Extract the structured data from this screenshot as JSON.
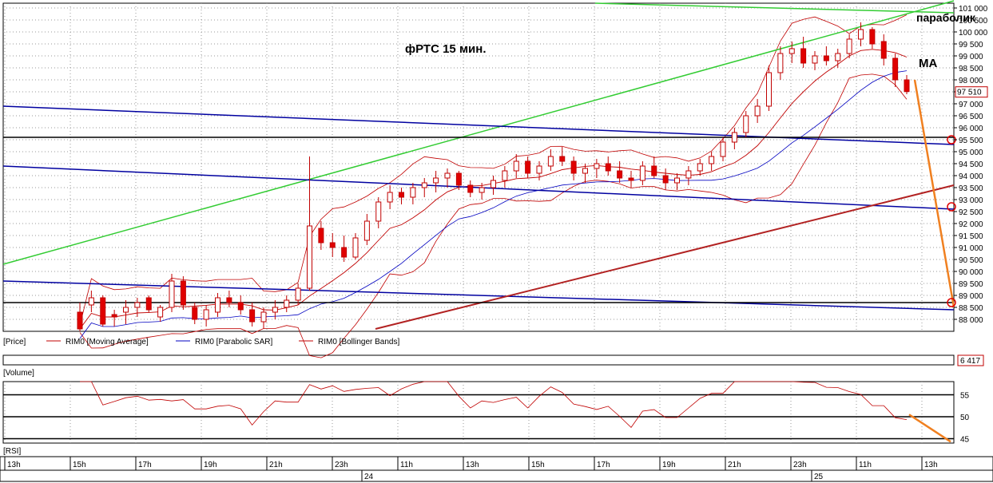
{
  "chart_data": {
    "type": "candlestick",
    "title": "фРТС   15 мин.",
    "annotations": {
      "parabolic": "параболик",
      "ma": "MA"
    },
    "price_panel": {
      "label": "[Price]",
      "ylim": [
        87500,
        101200
      ],
      "yticks": [
        "88 000",
        "88 500",
        "89 000",
        "89 500",
        "90 000",
        "90 500",
        "91 000",
        "91 500",
        "92 000",
        "92 500",
        "93 000",
        "93 500",
        "94 000",
        "94 500",
        "95 000",
        "95 500",
        "96 000",
        "96 500",
        "97 000",
        "97 500",
        "98 000",
        "98 500",
        "99 000",
        "99 500",
        "100 000",
        "100 500",
        "101 000"
      ],
      "last_price": "97 510",
      "last_price_value": 97510,
      "legend": [
        {
          "name": "RIM0 [Moving Average]",
          "color": "#c00000"
        },
        {
          "name": "RIM0 [Parabolic SAR]",
          "color": "#0000c0"
        },
        {
          "name": "RIM0 [Bollinger Bands]",
          "color": "#c00000"
        }
      ],
      "candles": [
        [
          88300,
          88700,
          87500,
          87600
        ],
        [
          88600,
          89200,
          88300,
          88900
        ],
        [
          88900,
          89000,
          87700,
          87800
        ],
        [
          88200,
          88400,
          87700,
          88100
        ],
        [
          88300,
          88800,
          87800,
          88500
        ],
        [
          88500,
          88900,
          88100,
          88700
        ],
        [
          88900,
          89000,
          88300,
          88400
        ],
        [
          88100,
          88600,
          87900,
          88500
        ],
        [
          88500,
          89900,
          88300,
          89600
        ],
        [
          89600,
          89800,
          88400,
          88600
        ],
        [
          88500,
          88700,
          87800,
          88000
        ],
        [
          88000,
          88600,
          87700,
          88400
        ],
        [
          88300,
          89100,
          88100,
          88900
        ],
        [
          88900,
          89200,
          88500,
          88700
        ],
        [
          88700,
          89000,
          88200,
          88400
        ],
        [
          88400,
          88700,
          87700,
          87900
        ],
        [
          87900,
          88500,
          87600,
          88300
        ],
        [
          88300,
          88800,
          88000,
          88500
        ],
        [
          88500,
          89000,
          88300,
          88800
        ],
        [
          88800,
          89500,
          88600,
          89300
        ],
        [
          89300,
          94800,
          89200,
          91900
        ],
        [
          91800,
          92100,
          90900,
          91200
        ],
        [
          91200,
          91600,
          90600,
          91000
        ],
        [
          91000,
          91500,
          90400,
          90600
        ],
        [
          90600,
          91600,
          90500,
          91400
        ],
        [
          91300,
          92400,
          91100,
          92100
        ],
        [
          92100,
          93100,
          91800,
          92900
        ],
        [
          92900,
          93600,
          92600,
          93300
        ],
        [
          93300,
          93500,
          92800,
          93100
        ],
        [
          93100,
          93700,
          92800,
          93500
        ],
        [
          93500,
          93900,
          93100,
          93700
        ],
        [
          93700,
          94200,
          93300,
          93900
        ],
        [
          93900,
          94300,
          93500,
          94100
        ],
        [
          94100,
          94200,
          93400,
          93600
        ],
        [
          93600,
          93800,
          93100,
          93300
        ],
        [
          93300,
          93700,
          93000,
          93500
        ],
        [
          93500,
          94000,
          93200,
          93800
        ],
        [
          93800,
          94400,
          93500,
          94200
        ],
        [
          94200,
          94900,
          93900,
          94600
        ],
        [
          94600,
          94800,
          93900,
          94100
        ],
        [
          94100,
          94600,
          93800,
          94400
        ],
        [
          94400,
          95100,
          94200,
          94800
        ],
        [
          94800,
          95200,
          94400,
          94600
        ],
        [
          94600,
          94800,
          93800,
          94100
        ],
        [
          94100,
          94500,
          93700,
          94300
        ],
        [
          94300,
          94700,
          93900,
          94500
        ],
        [
          94500,
          94800,
          94000,
          94200
        ],
        [
          94200,
          94600,
          93700,
          93900
        ],
        [
          93900,
          94200,
          93500,
          93800
        ],
        [
          93800,
          94600,
          93600,
          94400
        ],
        [
          94400,
          94800,
          93900,
          94000
        ],
        [
          94000,
          94300,
          93400,
          93700
        ],
        [
          93700,
          94100,
          93400,
          93900
        ],
        [
          93900,
          94400,
          93600,
          94200
        ],
        [
          94200,
          94700,
          94000,
          94500
        ],
        [
          94500,
          95000,
          94200,
          94800
        ],
        [
          94800,
          95600,
          94600,
          95400
        ],
        [
          95400,
          96000,
          95100,
          95800
        ],
        [
          95800,
          96700,
          95600,
          96500
        ],
        [
          96500,
          97200,
          96200,
          96900
        ],
        [
          96900,
          98600,
          96700,
          98300
        ],
        [
          98300,
          99400,
          98000,
          99100
        ],
        [
          99100,
          99600,
          98700,
          99300
        ],
        [
          99300,
          99800,
          98500,
          98700
        ],
        [
          98700,
          99200,
          98400,
          99000
        ],
        [
          99000,
          99400,
          98600,
          98800
        ],
        [
          98800,
          99300,
          98500,
          99100
        ],
        [
          99100,
          99900,
          98900,
          99700
        ],
        [
          99700,
          100400,
          99400,
          100100
        ],
        [
          100100,
          100200,
          99300,
          99500
        ],
        [
          99600,
          99900,
          98600,
          98900
        ],
        [
          98900,
          99100,
          97700,
          98000
        ],
        [
          98000,
          98200,
          97400,
          97510
        ]
      ]
    },
    "volume_panel": {
      "label": "[Volume]",
      "last_value": "6 417"
    },
    "rsi_panel": {
      "label": "[RSI]",
      "ylim": [
        44,
        58
      ],
      "yticks": [
        "45",
        "50",
        "55"
      ],
      "levels": [
        45,
        50,
        55
      ]
    },
    "x_axis": {
      "hour_labels": [
        "13h",
        "15h",
        "17h",
        "19h",
        "21h",
        "23h",
        "11h",
        "13h",
        "15h",
        "17h",
        "19h",
        "21h",
        "23h",
        "11h",
        "13h"
      ],
      "date_labels": [
        "24",
        "25"
      ]
    }
  }
}
